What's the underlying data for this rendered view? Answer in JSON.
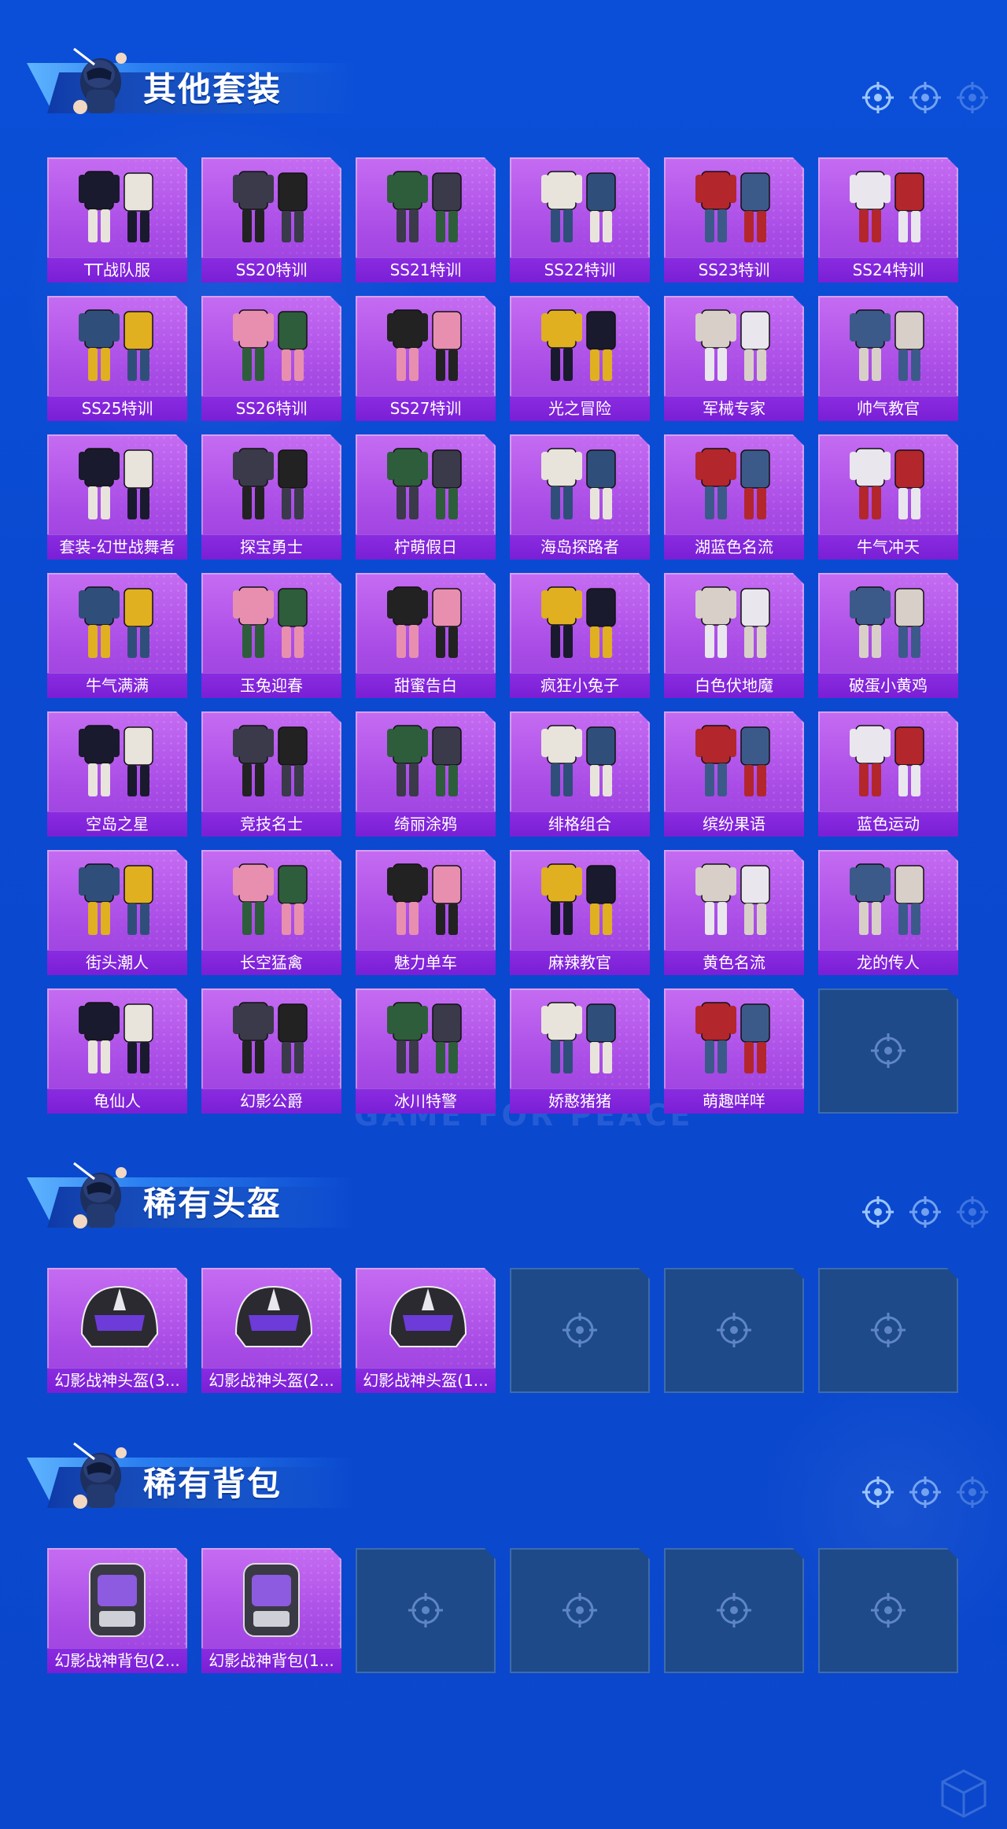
{
  "watermark": "GAME FOR PEACE",
  "colors": {
    "background": "#0a4ad2",
    "card_purple": "#a94ce6",
    "label_purple": "#7a1fd6",
    "empty_slot": "#1e4a8a"
  },
  "sections": [
    {
      "title": "其他套装",
      "items": [
        "TT战队服",
        "SS20特训",
        "SS21特训",
        "SS22特训",
        "SS23特训",
        "SS24特训",
        "SS25特训",
        "SS26特训",
        "SS27特训",
        "光之冒险",
        "军械专家",
        "帅气教官",
        "套装-幻世战舞者",
        "探宝勇士",
        "柠萌假日",
        "海岛探路者",
        "湖蓝色名流",
        "牛气冲天",
        "牛气满满",
        "玉兔迎春",
        "甜蜜告白",
        "疯狂小兔子",
        "白色伏地魔",
        "破蛋小黄鸡",
        "空岛之星",
        "竞技名士",
        "绮丽涂鸦",
        "绯格组合",
        "缤纷果语",
        "蓝色运动",
        "街头潮人",
        "长空猛禽",
        "魅力单车",
        "麻辣教官",
        "黄色名流",
        "龙的传人",
        "龟仙人",
        "幻影公爵",
        "冰川特警",
        "娇憨猪猪",
        "萌趣咩咩"
      ],
      "empty_slots": 1
    },
    {
      "title": "稀有头盔",
      "items": [
        "幻影战神头盔(3...",
        "幻影战神头盔(2...",
        "幻影战神头盔(1..."
      ],
      "empty_slots": 3
    },
    {
      "title": "稀有背包",
      "items": [
        "幻影战神背包(2...",
        "幻影战神背包(1..."
      ],
      "empty_slots": 4
    }
  ],
  "icons": {
    "section_crosshair": "crosshair-icon",
    "empty_slot": "crosshair-icon"
  }
}
